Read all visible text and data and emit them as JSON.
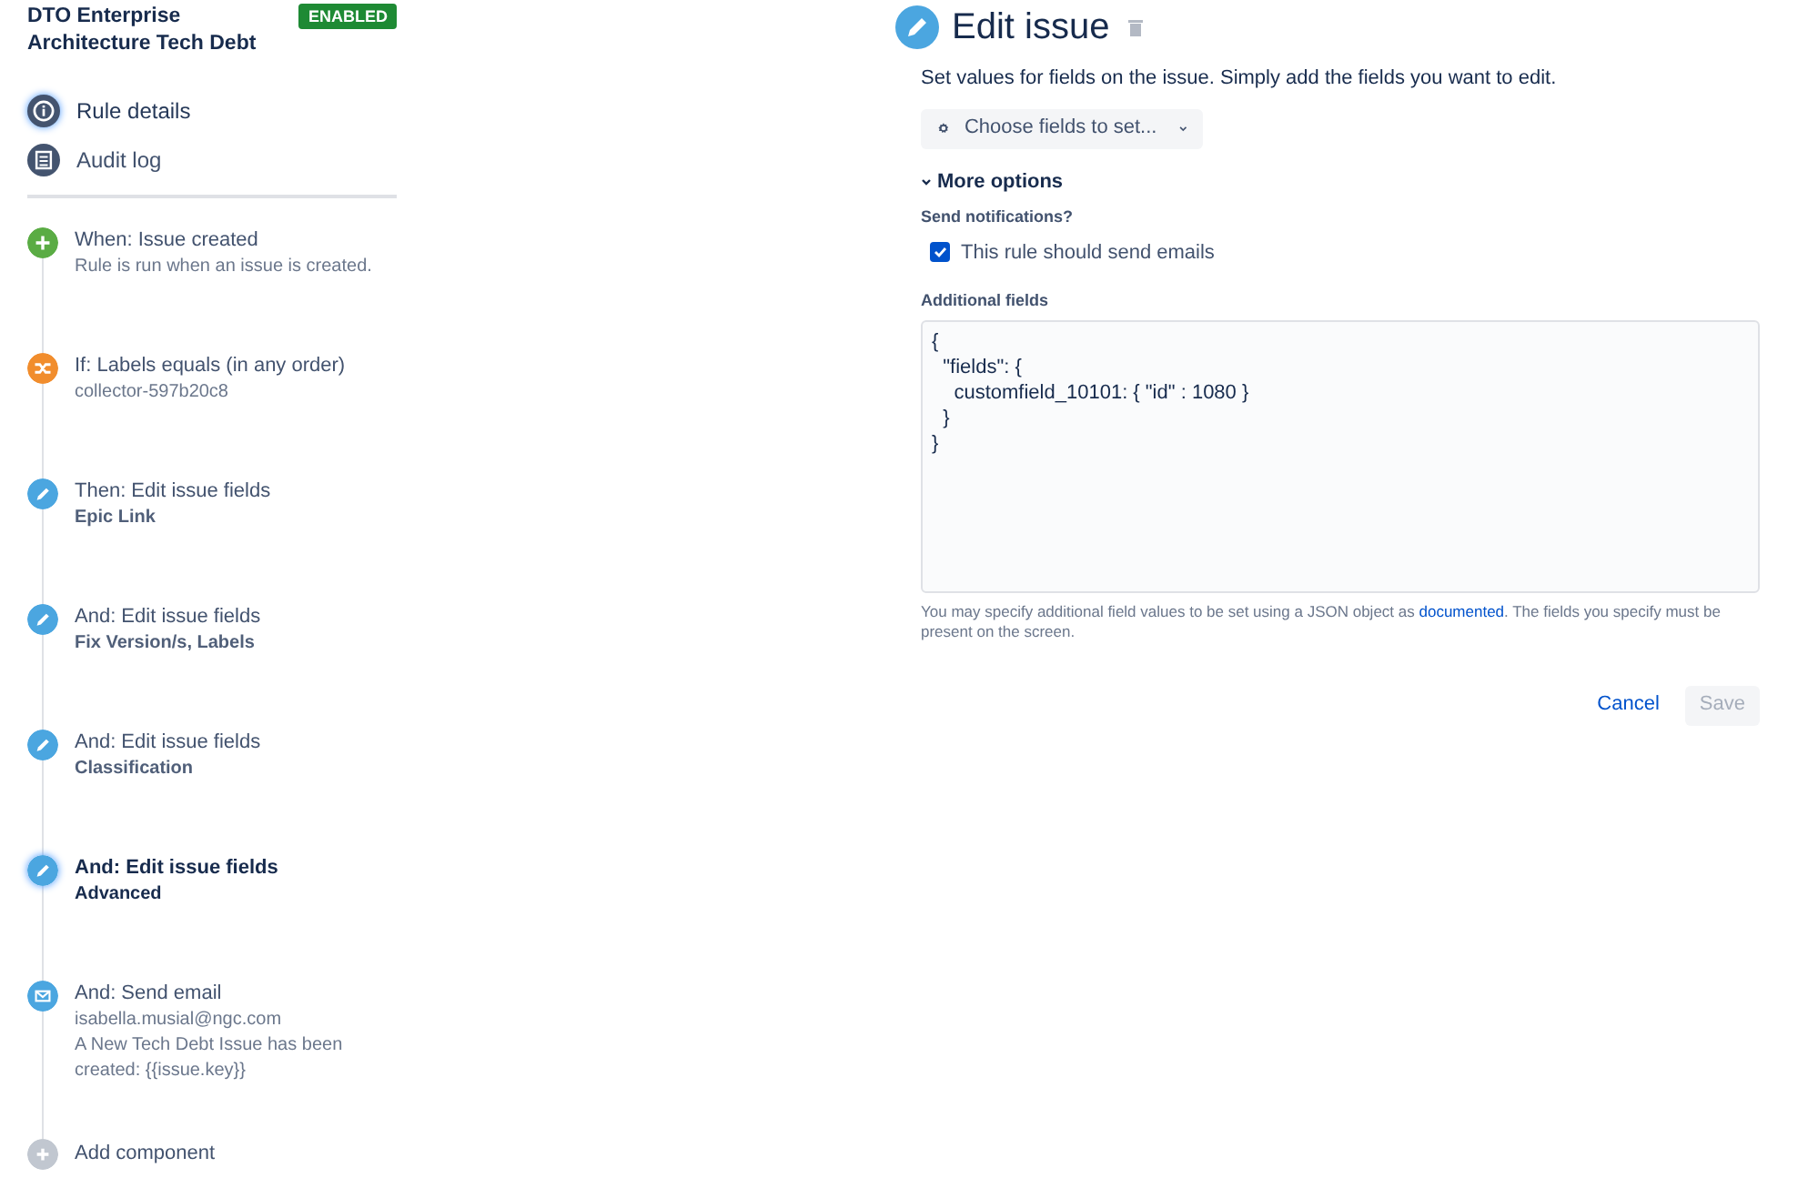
{
  "rule": {
    "title": "DTO Enterprise Architecture Tech Debt",
    "status": "ENABLED",
    "enabled": true
  },
  "nav": [
    {
      "label": "Rule details",
      "kind": "info",
      "selected": true
    },
    {
      "label": "Audit log",
      "kind": "log",
      "selected": false
    }
  ],
  "steps": [
    {
      "kind": "trigger",
      "title": "When: Issue created",
      "details": [
        "Rule is run when an issue is created."
      ],
      "selected": false
    },
    {
      "kind": "condition",
      "title": "If: Labels equals (in any order)",
      "details": [
        "collector-597b20c8"
      ],
      "selected": false
    },
    {
      "kind": "action",
      "title": "Then: Edit issue fields",
      "details": [
        "Epic Link"
      ],
      "selected": false
    },
    {
      "kind": "action",
      "title": "And: Edit issue fields",
      "details": [
        "Fix Version/s, Labels"
      ],
      "selected": false
    },
    {
      "kind": "action",
      "title": "And: Edit issue fields",
      "details": [
        "Classification"
      ],
      "selected": false
    },
    {
      "kind": "action",
      "title": "And: Edit issue fields",
      "details": [
        "Advanced"
      ],
      "selected": true
    },
    {
      "kind": "email",
      "title": "And: Send email",
      "details": [
        "isabella.musial@ngc.com",
        "A New Tech Debt Issue has been created: {{issue.key}}"
      ],
      "selected": false
    },
    {
      "kind": "add",
      "title": "Add component",
      "selected": false
    }
  ],
  "editor": {
    "title": "Edit issue",
    "description": "Set values for fields on the issue. Simply add the fields you want to edit.",
    "choose_button": "Choose fields to set...",
    "more_options": {
      "label": "More options",
      "expanded": true
    },
    "notifications": {
      "label": "Send notifications?",
      "checkbox": {
        "label": "This rule should send emails",
        "checked": true
      }
    },
    "additional_fields": {
      "label": "Additional fields",
      "value": "{\n  \"fields\": {\n    customfield_10101: { \"id\" : 1080 }\n  }\n}"
    },
    "help": {
      "before": "You may specify additional field values to be set using a JSON object as ",
      "link": "documented",
      "after": ". The fields you specify must be present on the screen."
    },
    "buttons": [
      {
        "label": "Cancel",
        "kind": "link",
        "disabled": false
      },
      {
        "label": "Save",
        "kind": "primary",
        "disabled": true
      }
    ]
  }
}
